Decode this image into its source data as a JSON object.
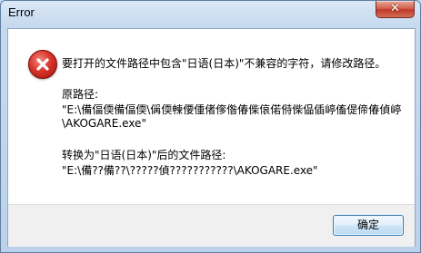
{
  "window": {
    "title": "Error"
  },
  "dialog": {
    "icon": "error-icon",
    "message": "要打开的文件路径中包含\"日语(日本)\"不兼容的字符，请修改路径。",
    "original_path_label": "原路径:",
    "original_path_line1": "\"E:\\備偪偄備偪偄\\偁偄朄偠偅偖偧偺偆偨偯偌偫偨偘偛嵉傗偍偙偆偵嵉",
    "original_path_line2": "\\AKOGARE.exe\"",
    "converted_label": "转换为\"日语(日本)\"后的文件路径:",
    "converted_path": "\"E:\\備??備??\\?????偵???????????\\AKOGARE.exe\""
  },
  "buttons": {
    "ok_label": "确定"
  },
  "colors": {
    "title_bg": "#c6d9ee",
    "close_button": "#c0392b",
    "error_icon": "#d9342a",
    "button_border": "#3c7fb1"
  }
}
